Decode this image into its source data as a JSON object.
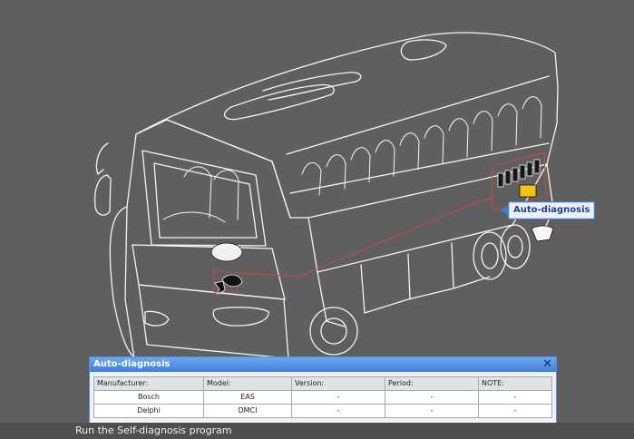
{
  "tooltip": {
    "label": "Auto-diagnosis"
  },
  "dialog": {
    "title": "Auto-diagnosis",
    "close_icon": "close-icon",
    "columns": [
      "Manufacturer:",
      "Model:",
      "Version:",
      "Period:",
      "NOTE:"
    ],
    "rows": [
      [
        "Bosch",
        "EAS",
        "-",
        "-",
        "-"
      ],
      [
        "Delphi",
        "DMCI",
        "-",
        "-",
        "-"
      ]
    ]
  },
  "status_bar": {
    "text": "Run the Self-diagnosis program"
  },
  "colors": {
    "background": "#5f5f5f",
    "line_art": "#ffffff",
    "wire": "#c54a4a",
    "dialog_title": "#4f8ee2",
    "tooltip_border": "#3b7fd9"
  }
}
